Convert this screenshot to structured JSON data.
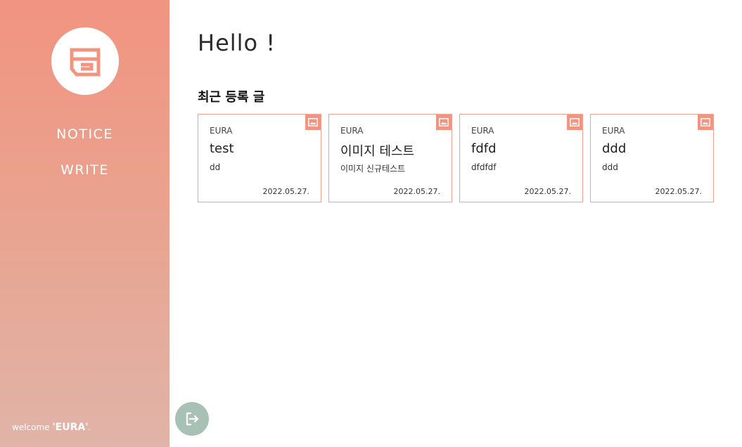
{
  "sidebar": {
    "nav": [
      {
        "label": "NOTICE"
      },
      {
        "label": "WRITE"
      }
    ],
    "welcome_prefix": "welcome ",
    "welcome_user": "'EURA'",
    "welcome_suffix": ".",
    "bg_top_color": "#f19480",
    "bg_bottom_color": "#e0b4a8"
  },
  "main": {
    "greeting": "Hello !",
    "section_title": "최근 등록 글"
  },
  "cards": [
    {
      "author": "EURA",
      "title": "test",
      "body": "dd",
      "date": "2022.05.27.",
      "badge_icon": "image-icon"
    },
    {
      "author": "EURA",
      "title": "이미지 테스트",
      "body": "이미지 신규테스트",
      "date": "2022.05.27.",
      "badge_icon": "image-icon"
    },
    {
      "author": "EURA",
      "title": "fdfd",
      "body": "dfdfdf",
      "date": "2022.05.27.",
      "badge_icon": "image-icon"
    },
    {
      "author": "EURA",
      "title": "ddd",
      "body": "ddd",
      "date": "2022.05.27.",
      "badge_icon": "image-icon"
    }
  ],
  "colors": {
    "accent": "#f19480",
    "card_border": "#f0a08e",
    "logout_button": "#a7c1b7"
  },
  "icons": {
    "logo": "eura-logo-icon",
    "logout": "logout-icon"
  }
}
